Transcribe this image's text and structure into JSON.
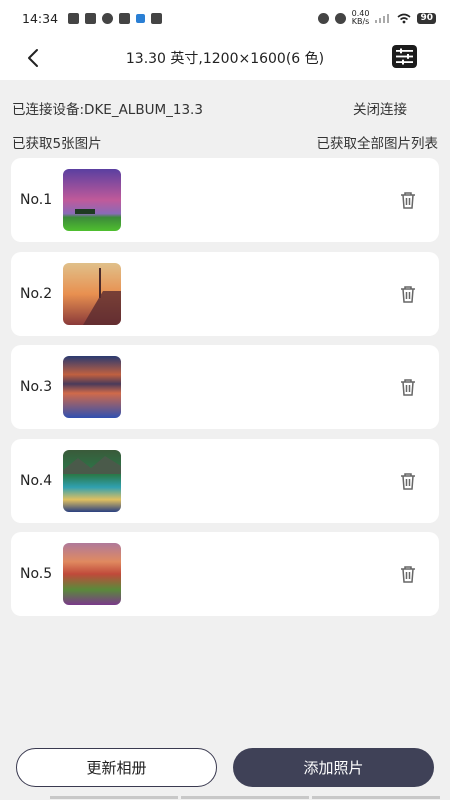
{
  "status_bar": {
    "time": "14:34",
    "net_speed_value": "0.40",
    "net_speed_unit": "KB/s",
    "battery": "90"
  },
  "header": {
    "title": "13.30 英寸,1200×1600(6 色)",
    "back_icon": "chevron-left-icon",
    "menu_icon": "settings-list-icon"
  },
  "connection": {
    "device_label": "已连接设备:DKE_ALBUM_13.3",
    "close_label": "关闭连接"
  },
  "photos_info": {
    "count_label": "已获取5张图片",
    "get_all_label": "已获取全部图片列表"
  },
  "photos": [
    {
      "label": "No.1",
      "theme": "purple-sky-green-field"
    },
    {
      "label": "No.2",
      "theme": "sunset-pier"
    },
    {
      "label": "No.3",
      "theme": "lake-sunset"
    },
    {
      "label": "No.4",
      "theme": "mountain-lake-beach"
    },
    {
      "label": "No.5",
      "theme": "sunset-hills-flowers"
    }
  ],
  "actions": {
    "update_label": "更新相册",
    "add_label": "添加照片"
  },
  "colors": {
    "primary": "#3f4157",
    "background": "#f0f0f0",
    "card": "#ffffff"
  }
}
